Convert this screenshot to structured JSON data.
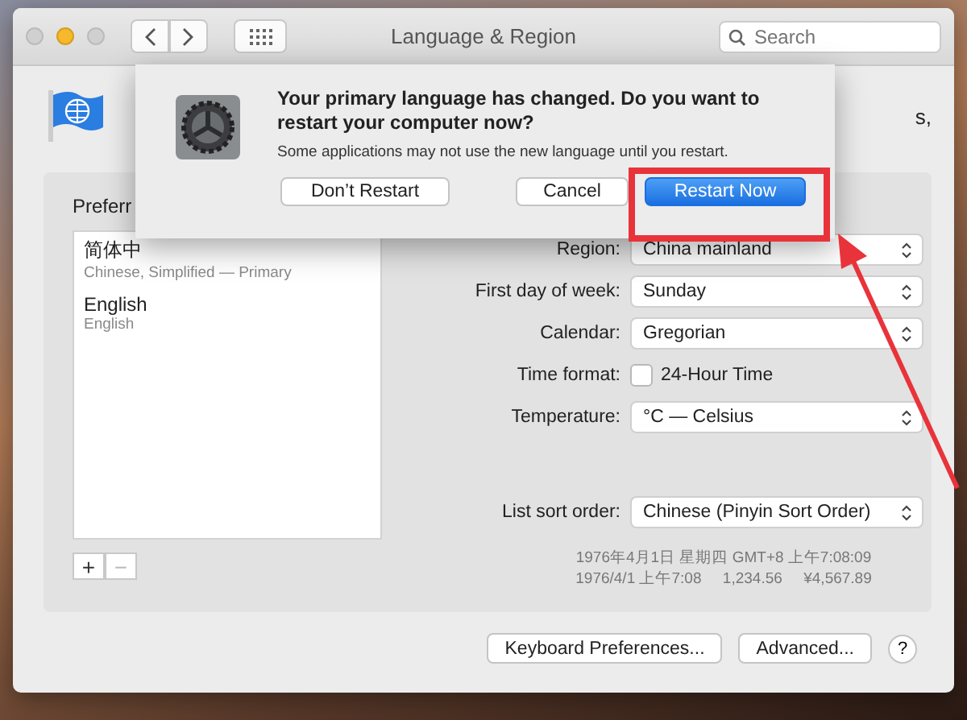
{
  "window": {
    "title": "Language & Region",
    "search": {
      "placeholder": "Search"
    },
    "traffic_lights": [
      {
        "kind": "close",
        "disabled": true
      },
      {
        "kind": "minimize",
        "disabled": false
      },
      {
        "kind": "zoom",
        "disabled": true
      }
    ]
  },
  "header": {
    "text_tail": "s,"
  },
  "preferred_languages": {
    "heading": "Preferr",
    "items": [
      {
        "name": "简体中",
        "detail": "Chinese, Simplified — Primary"
      },
      {
        "name": "English",
        "detail": "English"
      }
    ],
    "add": "+",
    "remove": "−"
  },
  "form": [
    {
      "kind": "popup",
      "label": "Region:",
      "value": "China mainland"
    },
    {
      "kind": "popup",
      "label": "First day of week:",
      "value": "Sunday"
    },
    {
      "kind": "popup",
      "label": "Calendar:",
      "value": "Gregorian"
    },
    {
      "kind": "checkbox",
      "label": "Time format:",
      "value": "24-Hour Time",
      "checked": false
    },
    {
      "kind": "popup",
      "label": "Temperature:",
      "value": "°C — Celsius"
    },
    {
      "kind": "gap"
    },
    {
      "kind": "popup",
      "label": "List sort order:",
      "value": "Chinese (Pinyin Sort Order)"
    }
  ],
  "samples": [
    "1976年4月1日 星期四 GMT+8 上午7:08:09",
    "1976/4/1 上午7:08     1,234.56     ¥4,567.89"
  ],
  "buttons": [
    "Keyboard Preferences...",
    "Advanced...",
    "?"
  ],
  "dialog": {
    "title": "Your primary language has changed. Do you want to restart your computer now?",
    "message": "Some applications may not use the new language until you restart.",
    "buttons": [
      {
        "label": "Don’t Restart",
        "selected": false
      },
      {
        "label": "Cancel",
        "selected": false
      },
      {
        "label": "Restart Now",
        "selected": true
      }
    ]
  },
  "annotation": {
    "highlight": true
  }
}
